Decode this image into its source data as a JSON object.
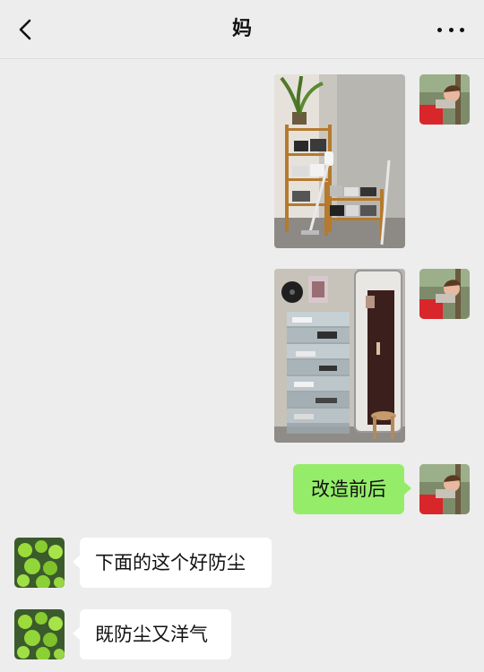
{
  "header": {
    "title": "妈",
    "back_icon": "chevron-left-icon",
    "more_icon": "more-dots-icon"
  },
  "messages": [
    {
      "side": "right",
      "type": "image",
      "content": "photo-before-shoe-rack"
    },
    {
      "side": "right",
      "type": "image",
      "content": "photo-after-shoe-boxes"
    },
    {
      "side": "right",
      "type": "text",
      "text": "改造前后"
    },
    {
      "side": "left",
      "type": "text",
      "text": "下面的这个好防尘"
    },
    {
      "side": "left",
      "type": "text",
      "text": "既防尘又洋气"
    }
  ],
  "colors": {
    "background": "#ededed",
    "self_bubble": "#95ec69",
    "other_bubble": "#ffffff"
  }
}
